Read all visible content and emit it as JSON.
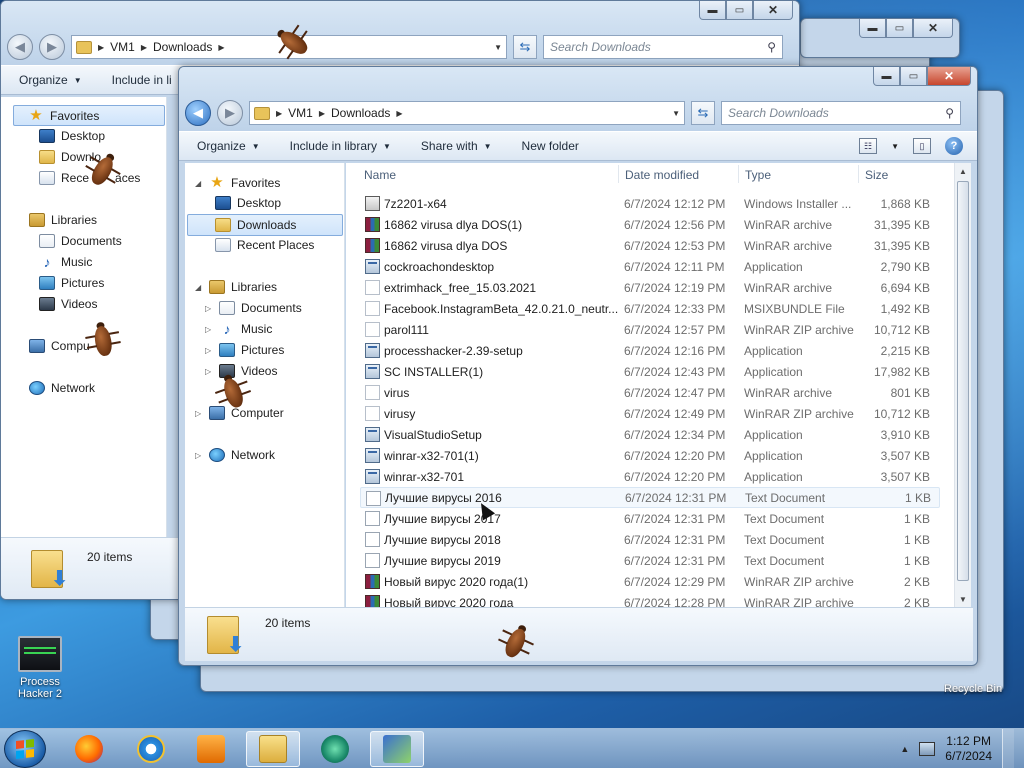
{
  "colors": {
    "accent": "#2a78c6",
    "selection": "#cfe4fb",
    "close_button": "#c7462d"
  },
  "back_window": {
    "address": {
      "root": "VM1",
      "folder": "Downloads"
    },
    "search_placeholder": "Search Downloads",
    "toolbar": {
      "organize": "Organize",
      "include_partial": "Include in li"
    },
    "nav": {
      "favorites": "Favorites",
      "desktop": "Desktop",
      "downloads": "Downlo",
      "recent": "Rece",
      "recent_tail": "aces",
      "libraries": "Libraries",
      "documents": "Documents",
      "music": "Music",
      "pictures": "Pictures",
      "videos": "Videos",
      "computer": "Compu",
      "network": "Network"
    },
    "items_count": "20 items"
  },
  "window": {
    "address": {
      "root": "VM1",
      "folder": "Downloads"
    },
    "search_placeholder": "Search Downloads",
    "toolbar": {
      "organize": "Organize",
      "include_in_library": "Include in library",
      "share_with": "Share with",
      "new_folder": "New folder"
    },
    "nav": {
      "favorites": "Favorites",
      "desktop": "Desktop",
      "downloads": "Downloads",
      "recent_places": "Recent Places",
      "libraries": "Libraries",
      "documents": "Documents",
      "music": "Music",
      "pictures": "Pictures",
      "videos": "Videos",
      "computer": "Computer",
      "network": "Network"
    },
    "columns": {
      "name": "Name",
      "date_modified": "Date modified",
      "type": "Type",
      "size": "Size"
    },
    "files": [
      {
        "name": "7z2201-x64",
        "date": "6/7/2024 12:12 PM",
        "type": "Windows Installer ...",
        "size": "1,868 KB",
        "icon": "msi"
      },
      {
        "name": "16862 virusa dlya DOS(1)",
        "date": "6/7/2024 12:56 PM",
        "type": "WinRAR archive",
        "size": "31,395 KB",
        "icon": "rar"
      },
      {
        "name": "16862 virusa dlya DOS",
        "date": "6/7/2024 12:53 PM",
        "type": "WinRAR archive",
        "size": "31,395 KB",
        "icon": "rar"
      },
      {
        "name": "cockroachondesktop",
        "date": "6/7/2024 12:11 PM",
        "type": "Application",
        "size": "2,790 KB",
        "icon": "exe"
      },
      {
        "name": "extrimhack_free_15.03.2021",
        "date": "6/7/2024 12:19 PM",
        "type": "WinRAR archive",
        "size": "6,694 KB",
        "icon": "blank"
      },
      {
        "name": "Facebook.InstagramBeta_42.0.21.0_neutr...",
        "date": "6/7/2024 12:33 PM",
        "type": "MSIXBUNDLE File",
        "size": "1,492 KB",
        "icon": "blank"
      },
      {
        "name": "parol111",
        "date": "6/7/2024 12:57 PM",
        "type": "WinRAR ZIP archive",
        "size": "10,712 KB",
        "icon": "blank"
      },
      {
        "name": "processhacker-2.39-setup",
        "date": "6/7/2024 12:16 PM",
        "type": "Application",
        "size": "2,215 KB",
        "icon": "exe"
      },
      {
        "name": "SC INSTALLER(1)",
        "date": "6/7/2024 12:43 PM",
        "type": "Application",
        "size": "17,982 KB",
        "icon": "exe"
      },
      {
        "name": "virus",
        "date": "6/7/2024 12:47 PM",
        "type": "WinRAR archive",
        "size": "801 KB",
        "icon": "blank"
      },
      {
        "name": "virusy",
        "date": "6/7/2024 12:49 PM",
        "type": "WinRAR ZIP archive",
        "size": "10,712 KB",
        "icon": "blank"
      },
      {
        "name": "VisualStudioSetup",
        "date": "6/7/2024 12:34 PM",
        "type": "Application",
        "size": "3,910 KB",
        "icon": "exe"
      },
      {
        "name": "winrar-x32-701(1)",
        "date": "6/7/2024 12:20 PM",
        "type": "Application",
        "size": "3,507 KB",
        "icon": "exe"
      },
      {
        "name": "winrar-x32-701",
        "date": "6/7/2024 12:20 PM",
        "type": "Application",
        "size": "3,507 KB",
        "icon": "exe"
      },
      {
        "name": "Лучшие вирусы 2016",
        "date": "6/7/2024 12:31 PM",
        "type": "Text Document",
        "size": "1 KB",
        "icon": "txt"
      },
      {
        "name": "Лучшие вирусы 2017",
        "date": "6/7/2024 12:31 PM",
        "type": "Text Document",
        "size": "1 KB",
        "icon": "txt"
      },
      {
        "name": "Лучшие вирусы 2018",
        "date": "6/7/2024 12:31 PM",
        "type": "Text Document",
        "size": "1 KB",
        "icon": "txt"
      },
      {
        "name": "Лучшие вирусы 2019",
        "date": "6/7/2024 12:31 PM",
        "type": "Text Document",
        "size": "1 KB",
        "icon": "txt"
      },
      {
        "name": "Новый вирус 2020 года(1)",
        "date": "6/7/2024 12:29 PM",
        "type": "WinRAR ZIP archive",
        "size": "2 KB",
        "icon": "rar"
      },
      {
        "name": "Новый вирус 2020 года",
        "date": "6/7/2024 12:28 PM",
        "type": "WinRAR ZIP archive",
        "size": "2 KB",
        "icon": "rar"
      }
    ],
    "items_count": "20 items"
  },
  "desktop": {
    "icons": [
      {
        "label": "Process Hacker 2",
        "icon": "process-hacker-icon"
      }
    ],
    "recycle_bin_partial": "Recycle Bin"
  },
  "taskbar": {
    "time": "1:12 PM",
    "date": "6/7/2024",
    "pinned": [
      "firefox-icon",
      "internet-explorer-icon",
      "media-player-icon",
      "explorer-icon",
      "process-hacker-icon",
      "setup-icon"
    ]
  }
}
